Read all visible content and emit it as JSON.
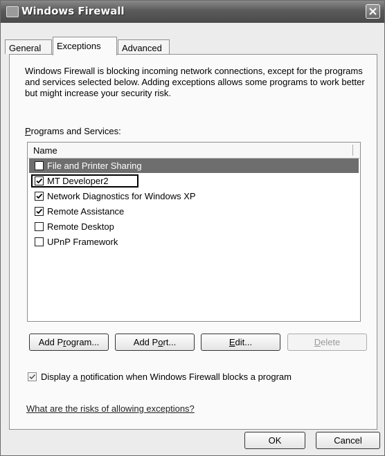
{
  "window": {
    "title": "Windows Firewall",
    "icon": "firewall-app-icon",
    "close_icon": "close-icon"
  },
  "tabs": [
    {
      "label": "General",
      "active": false
    },
    {
      "label": "Exceptions",
      "active": true
    },
    {
      "label": "Advanced",
      "active": false
    }
  ],
  "exceptions": {
    "description": "Windows Firewall is blocking incoming network connections, except for the programs and services selected below. Adding exceptions allows some programs to work better but might increase your security risk.",
    "list_label_prefix": "P",
    "list_label_rest": "rograms and Services:",
    "column_header": "Name",
    "items": [
      {
        "label": "File and Printer Sharing",
        "checked": false
      },
      {
        "label": "MT Developer2",
        "checked": true
      },
      {
        "label": "Network Diagnostics for Windows XP",
        "checked": true
      },
      {
        "label": "Remote Assistance",
        "checked": true
      },
      {
        "label": "Remote Desktop",
        "checked": false
      },
      {
        "label": "UPnP Framework",
        "checked": false
      }
    ],
    "buttons": {
      "add_program": {
        "pre": "Add P",
        "u": "r",
        "post": "ogram..."
      },
      "add_port": {
        "pre": "Add P",
        "u": "o",
        "post": "rt..."
      },
      "edit": {
        "pre": "",
        "u": "E",
        "post": "dit..."
      },
      "delete": {
        "pre": "",
        "u": "D",
        "post": "elete"
      }
    },
    "notification": {
      "pre": "Display a ",
      "u": "n",
      "post": "otification when Windows Firewall blocks a program",
      "checked": true
    },
    "risks_link": "What are the risks of allowing exceptions?"
  },
  "footer": {
    "ok_label": "OK",
    "cancel_label": "Cancel"
  }
}
